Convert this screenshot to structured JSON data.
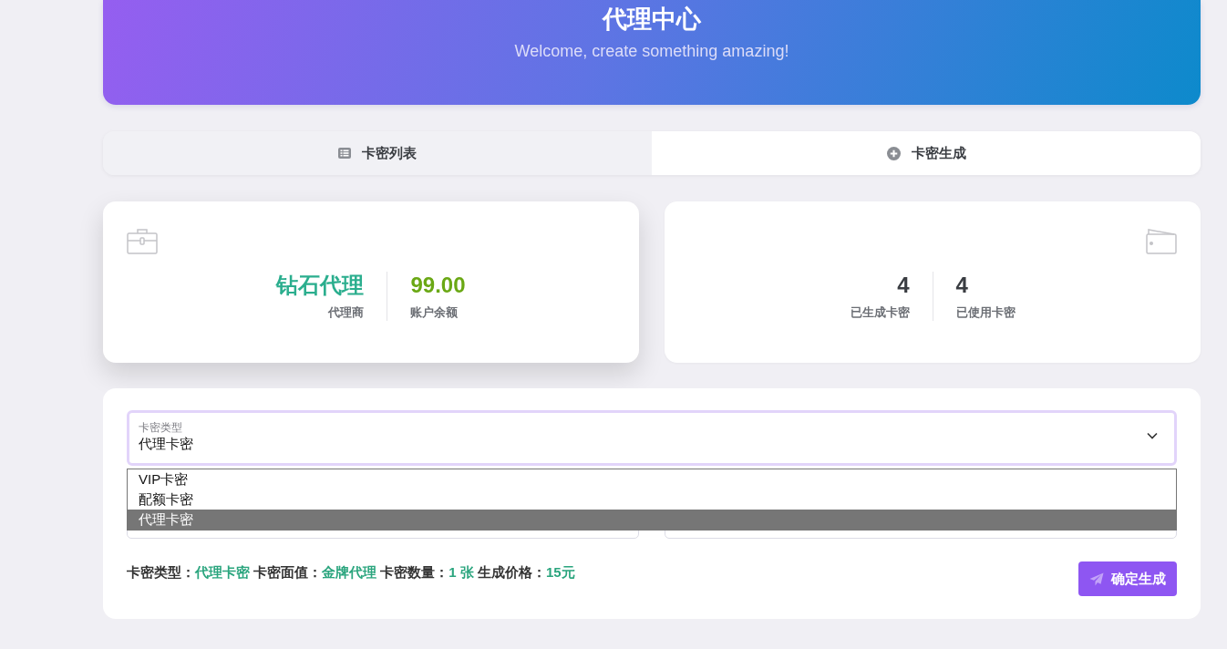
{
  "header": {
    "title": "代理中心",
    "subtitle": "Welcome, create something amazing!"
  },
  "tabs": [
    {
      "label": "卡密列表",
      "kind": "list",
      "selected": false
    },
    {
      "label": "卡密生成",
      "kind": "plus",
      "selected": true
    }
  ],
  "stat_cards": [
    {
      "kind": "briefcase",
      "hovered": true,
      "stats": [
        {
          "value": "钻石代理",
          "label": "代理商",
          "color": "#2bae8e"
        },
        {
          "value": "99.00",
          "label": "账户余额",
          "color": "#6aa814"
        }
      ]
    },
    {
      "kind": "wallet",
      "hovered": false,
      "stats": [
        {
          "value": "4",
          "label": "已生成卡密",
          "color": "#3a3d42"
        },
        {
          "value": "4",
          "label": "已使用卡密",
          "color": "#3a3d42"
        }
      ]
    }
  ],
  "form": {
    "select": {
      "label": "卡密类型",
      "value": "代理卡密",
      "expanded": true,
      "options": [
        {
          "label": "VIP卡密",
          "selected": false
        },
        {
          "label": "配额卡密",
          "selected": false
        },
        {
          "label": "代理卡密",
          "selected": true
        }
      ]
    },
    "summary": [
      {
        "label": "卡密类型：",
        "value": "代理卡密"
      },
      {
        "label": "卡密面值：",
        "value": "金牌代理"
      },
      {
        "label": "卡密数量：",
        "value": "1 张"
      },
      {
        "label": "生成价格：",
        "value": "15元"
      }
    ],
    "submit_button": "确定生成"
  }
}
